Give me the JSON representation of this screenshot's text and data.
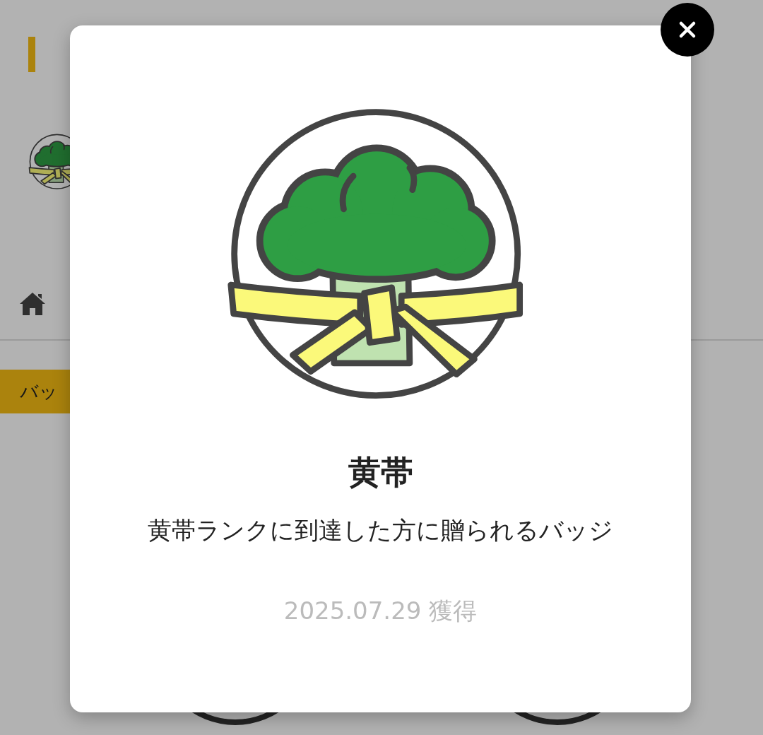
{
  "page": {
    "tabs": [
      {
        "label": "バッ",
        "selected": true
      }
    ]
  },
  "modal": {
    "title": "黄帯",
    "description": "黄帯ランクに到達した方に贈られるバッジ",
    "earned": "2025.07.29 獲得"
  }
}
